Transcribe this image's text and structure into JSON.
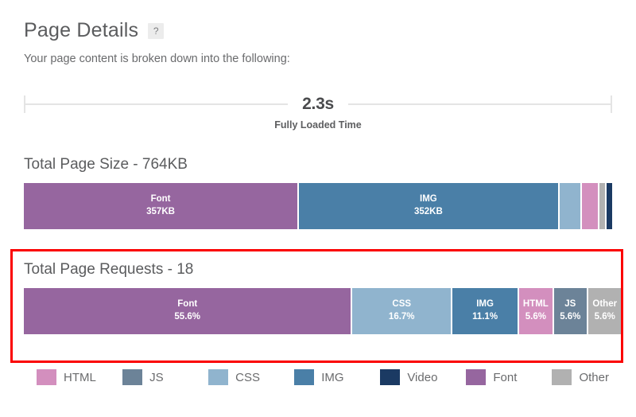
{
  "header": {
    "title": "Page Details",
    "help_icon_label": "?",
    "subtitle": "Your page content is broken down into the following:"
  },
  "fully_loaded": {
    "value": "2.3s",
    "label": "Fully Loaded Time"
  },
  "sections": [
    {
      "heading": "Total Page Size - 764KB"
    },
    {
      "heading": "Total Page Requests - 18"
    }
  ],
  "legend": [
    {
      "label": "HTML",
      "color": "#d38fbe"
    },
    {
      "label": "JS",
      "color": "#6c8398"
    },
    {
      "label": "CSS",
      "color": "#90b4ce"
    },
    {
      "label": "IMG",
      "color": "#4a7fa7"
    },
    {
      "label": "Video",
      "color": "#1b3a63"
    },
    {
      "label": "Font",
      "color": "#96669f"
    },
    {
      "label": "Other",
      "color": "#b1b1b1"
    }
  ],
  "colors": {
    "html": "#d38fbe",
    "js": "#6c8398",
    "css": "#90b4ce",
    "img": "#4a7fa7",
    "video": "#1b3a63",
    "font": "#96669f",
    "other": "#b1b1b1",
    "highlight": "#fb0000",
    "rule": "#e4e4e4",
    "text": "#5b5c5e"
  },
  "chart_data": [
    {
      "type": "bar",
      "title": "Total Page Size - 764KB",
      "orientation": "horizontal-stacked",
      "total": "764KB",
      "unit": "KB",
      "categories": [
        "Font",
        "IMG",
        "CSS",
        "HTML",
        "Other",
        "Video"
      ],
      "values": [
        357,
        352,
        28,
        18,
        5,
        4
      ],
      "labels": [
        "357KB",
        "352KB",
        "",
        "",
        "",
        ""
      ],
      "show_labels": [
        true,
        true,
        false,
        false,
        false,
        false
      ],
      "widths_pct": [
        46.5,
        44.0,
        3.6,
        2.6,
        1.0,
        1.0
      ],
      "colors": [
        "#96669f",
        "#4a7fa7",
        "#90b4ce",
        "#d38fbe",
        "#b1b1b1",
        "#1b3a63"
      ]
    },
    {
      "type": "bar",
      "title": "Total Page Requests - 18",
      "orientation": "horizontal-stacked",
      "total": "18",
      "unit": "requests",
      "categories": [
        "Font",
        "CSS",
        "IMG",
        "HTML",
        "JS",
        "Other"
      ],
      "values": [
        10,
        3,
        2,
        1,
        1,
        1
      ],
      "labels": [
        "55.6%",
        "16.7%",
        "11.1%",
        "5.6%",
        "5.6%",
        "5.6%"
      ],
      "show_labels": [
        true,
        true,
        true,
        true,
        true,
        true
      ],
      "widths_pct": [
        55.6,
        16.7,
        11.1,
        5.6,
        5.6,
        5.6
      ],
      "colors": [
        "#96669f",
        "#90b4ce",
        "#4a7fa7",
        "#d38fbe",
        "#6c8398",
        "#b1b1b1"
      ]
    }
  ]
}
